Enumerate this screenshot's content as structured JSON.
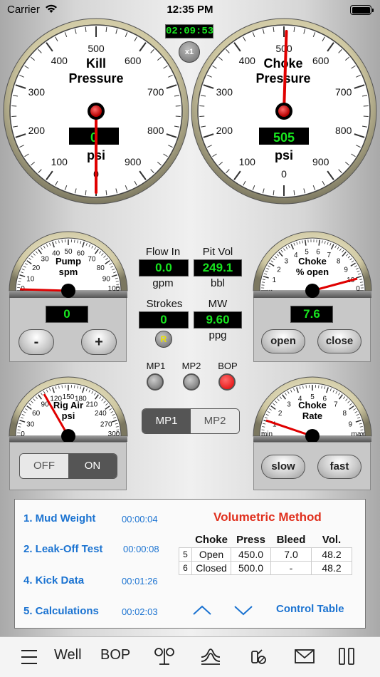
{
  "status_bar": {
    "carrier": "Carrier",
    "time": "12:35 PM"
  },
  "timer": {
    "elapsed": "02:09:53",
    "speed": "x1"
  },
  "kill_gauge": {
    "title_line1": "Kill",
    "title_line2": "Pressure",
    "unit": "psi",
    "display": "0",
    "value": 0,
    "min": 0,
    "max": 1000,
    "ticks": [
      "0",
      "100",
      "200",
      "300",
      "400",
      "500",
      "600",
      "700",
      "800",
      "900"
    ]
  },
  "choke_gauge": {
    "title_line1": "Choke",
    "title_line2": "Pressure",
    "unit": "psi",
    "display": "505",
    "value": 505,
    "min": 0,
    "max": 1000,
    "ticks": [
      "0",
      "100",
      "200",
      "300",
      "400",
      "500",
      "600",
      "700",
      "800",
      "900"
    ]
  },
  "pump_gauge": {
    "title_line1": "Pump",
    "title_line2": "spm",
    "value": 0,
    "max": 100,
    "ticks": [
      "0",
      "10",
      "20",
      "30",
      "40",
      "50",
      "60",
      "70",
      "80",
      "90",
      "100"
    ],
    "display": "0",
    "minus_label": "-",
    "plus_label": "+"
  },
  "choke_open_gauge": {
    "title_line1": "Choke",
    "title_line2": "% open",
    "value": 7.6,
    "max": 10,
    "ticks": [
      "...",
      "1",
      "2",
      "3",
      "4",
      "5",
      "6",
      "7",
      "8",
      "9",
      "10",
      "0"
    ],
    "display": "7.6",
    "open_label": "open",
    "close_label": "close"
  },
  "rig_air_gauge": {
    "title_line1": "Rig Air",
    "title_line2": "psi",
    "value": 90,
    "max": 300,
    "ticks": [
      "0",
      "30",
      "60",
      "90",
      "120",
      "150",
      "180",
      "210",
      "240",
      "270",
      "300"
    ],
    "off_label": "OFF",
    "on_label": "ON",
    "selected": "ON"
  },
  "choke_rate_gauge": {
    "title_line1": "Choke",
    "title_line2": "Rate",
    "value": 0.1,
    "ticks": [
      "min",
      "1",
      "2",
      "3",
      "4",
      "5",
      "6",
      "7",
      "8",
      "9",
      "max"
    ],
    "slow_label": "slow",
    "fast_label": "fast"
  },
  "readouts": {
    "flow_in": {
      "label": "Flow In",
      "value": "0.0",
      "unit": "gpm"
    },
    "pit_vol": {
      "label": "Pit Vol",
      "value": "249.1",
      "unit": "bbl"
    },
    "strokes": {
      "label": "Strokes",
      "value": "0",
      "reset": "R"
    },
    "mw": {
      "label": "MW",
      "value": "9.60",
      "unit": "ppg"
    }
  },
  "indicators": {
    "mp1": "MP1",
    "mp2": "MP2",
    "bop": "BOP",
    "bop_color": "#e00000"
  },
  "pump_selector": {
    "mp1": "MP1",
    "mp2": "MP2",
    "selected": "MP1"
  },
  "menu": [
    {
      "label": "1. Mud Weight",
      "time": "00:00:04"
    },
    {
      "label": "2. Leak-Off Test",
      "time": "00:00:08"
    },
    {
      "label": "4. Kick Data",
      "time": "00:01:26"
    },
    {
      "label": "5. Calculations",
      "time": "00:02:03"
    }
  ],
  "volumetric": {
    "title": "Volumetric Method",
    "columns": [
      "Choke",
      "Press",
      "Bleed",
      "Vol."
    ],
    "rows": [
      {
        "idx": "5",
        "choke": "Open",
        "press": "450.0",
        "bleed": "7.0",
        "vol": "48.2"
      },
      {
        "idx": "6",
        "choke": "Closed",
        "press": "500.0",
        "bleed": "-",
        "vol": "48.2"
      }
    ],
    "control_table": "Control Table"
  },
  "tab_bar": {
    "well": "Well",
    "bop": "BOP"
  },
  "colors": {
    "lcd_green": "#18e51f",
    "needle_red": "#e00000",
    "link_blue": "#1b73d1"
  }
}
